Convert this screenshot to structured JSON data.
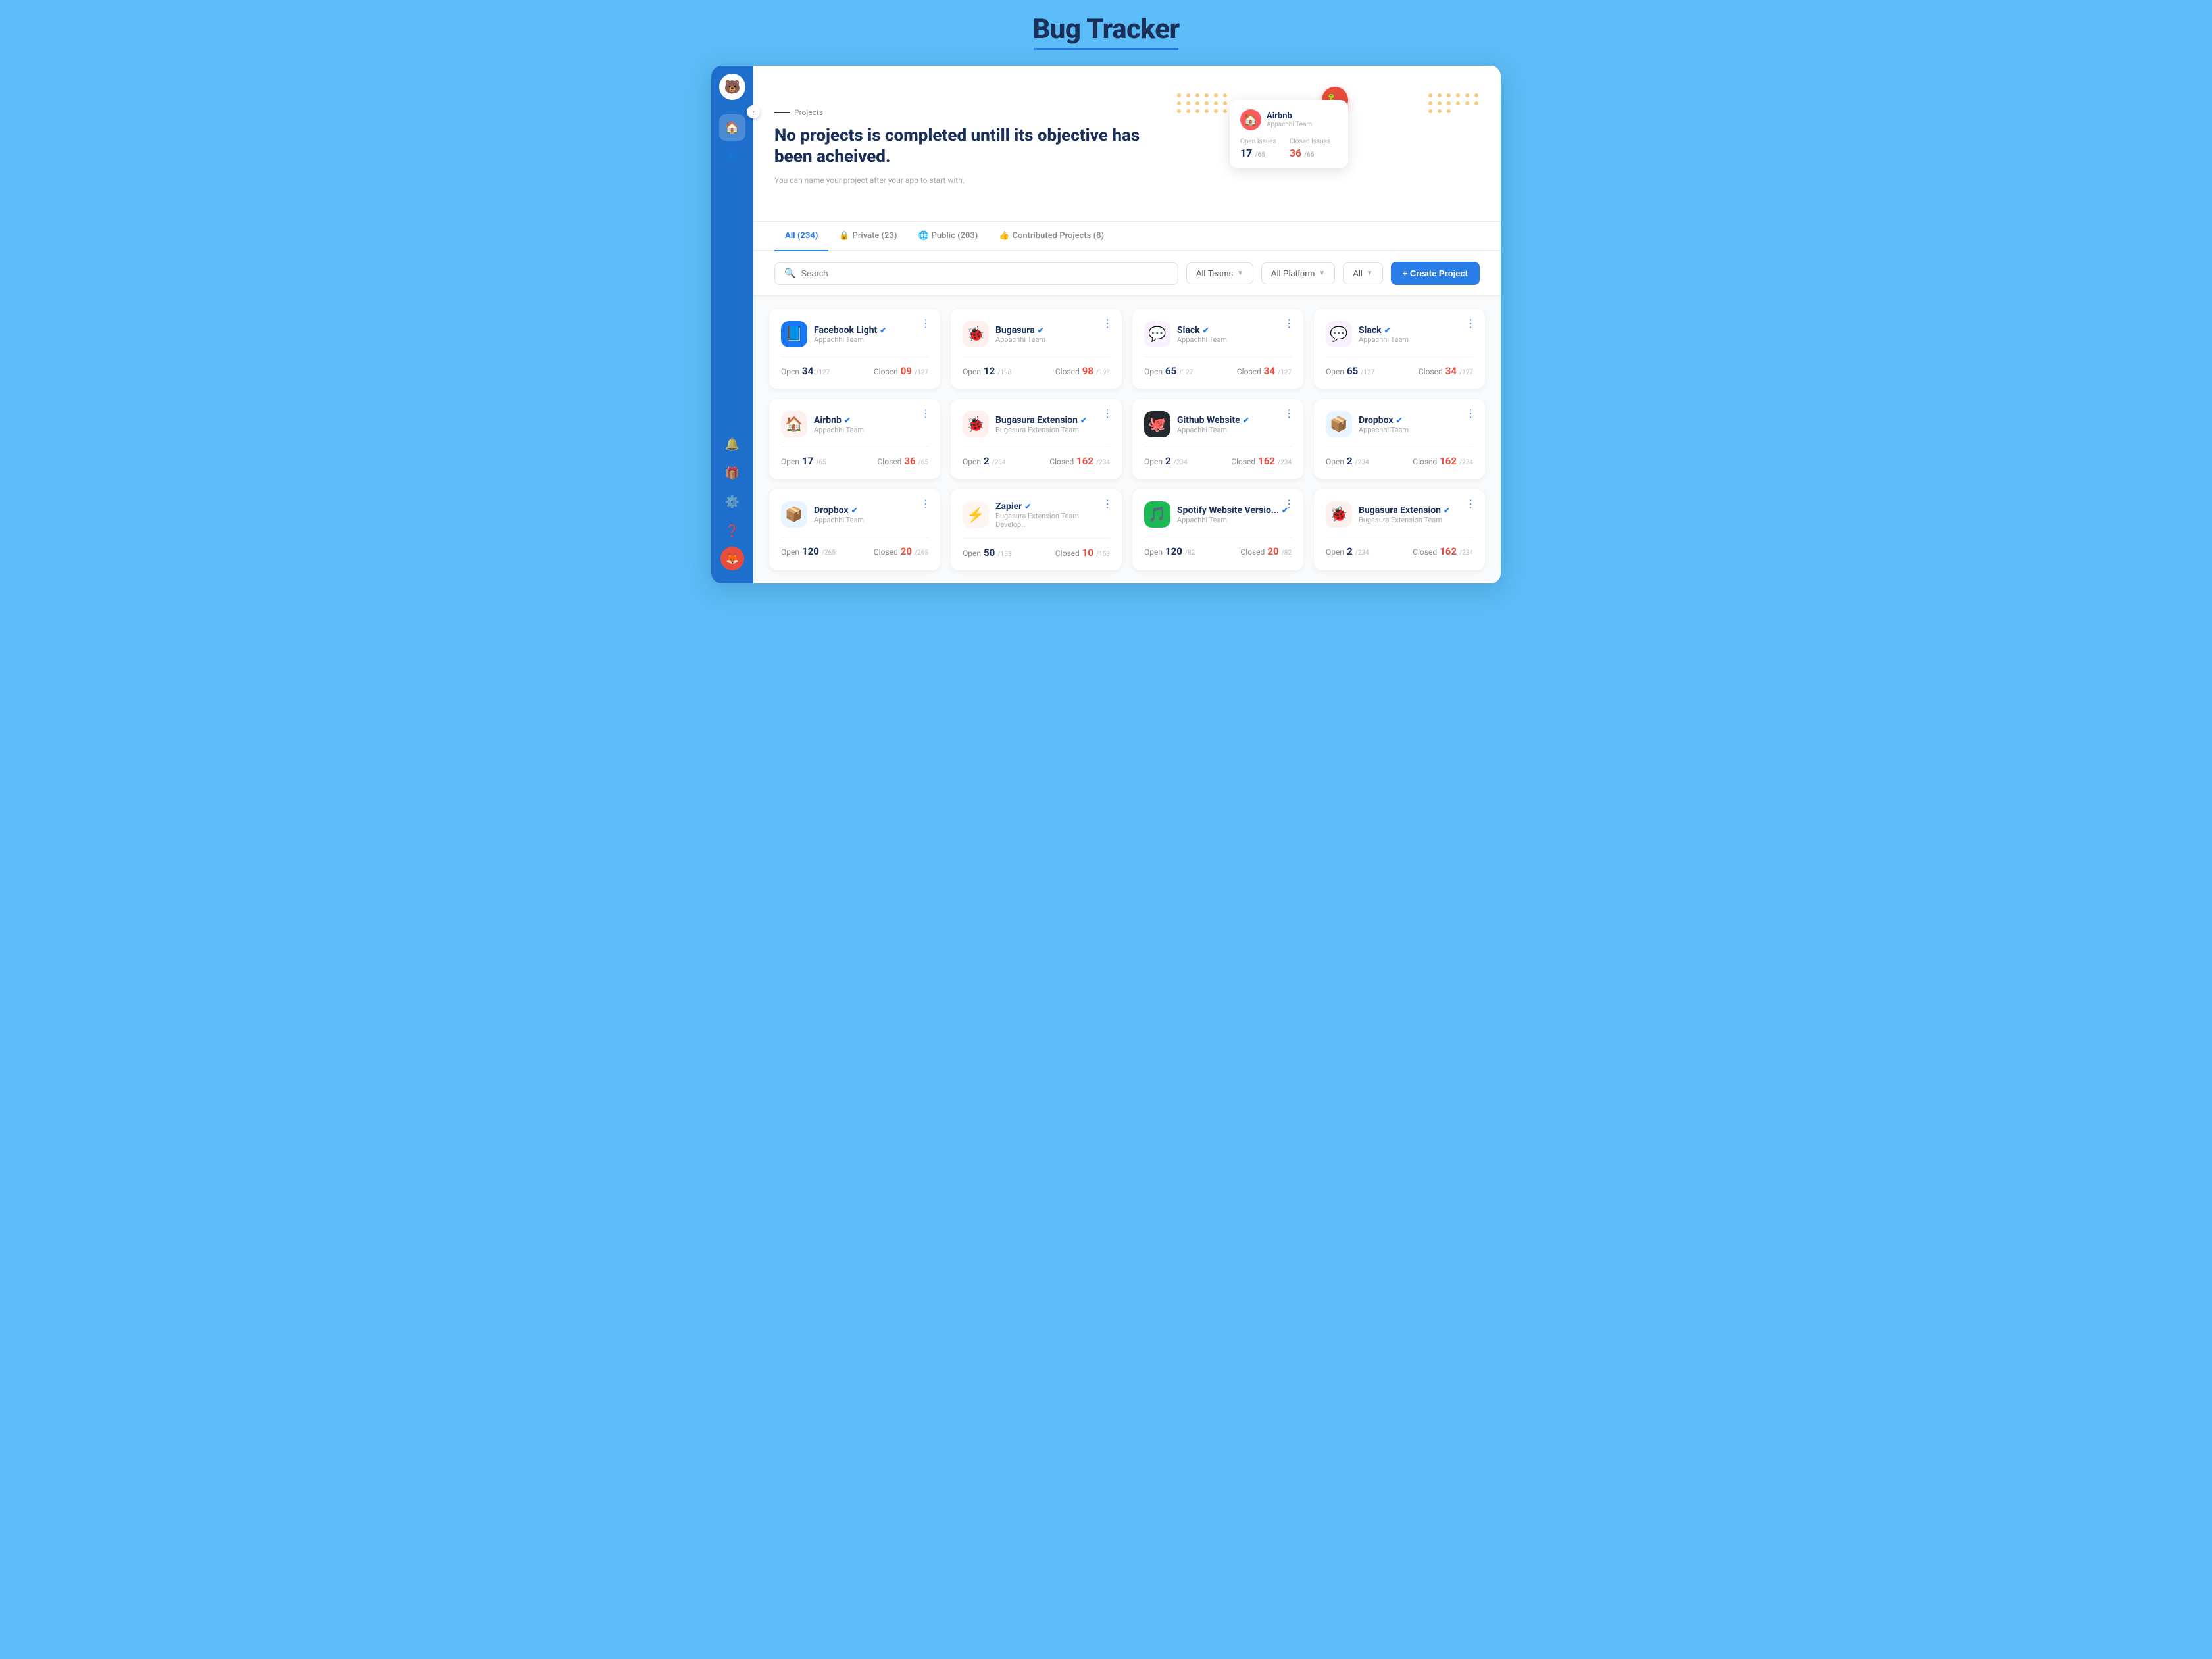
{
  "header": {
    "title": "Bug Tracker"
  },
  "sidebar": {
    "logo": "🐻",
    "items": [
      {
        "id": "home",
        "icon": "🏠",
        "active": true
      },
      {
        "id": "user",
        "icon": "👤",
        "active": false
      }
    ],
    "bottom_items": [
      {
        "id": "bell",
        "icon": "🔔"
      },
      {
        "id": "gift",
        "icon": "🎁"
      },
      {
        "id": "gear",
        "icon": "⚙️"
      },
      {
        "id": "help",
        "icon": "❓"
      }
    ]
  },
  "hero": {
    "label": "Projects",
    "title": "No projects is completed untill its objective has been acheived.",
    "subtitle": "You can name your project after your app to start with.",
    "preview_card": {
      "name": "Airbnb",
      "team": "Appachhi Team",
      "open_issues_label": "Open Issues",
      "open_count": "17",
      "open_total": "/65",
      "closed_issues_label": "Closed Issues",
      "closed_count": "36",
      "closed_total": "/65"
    }
  },
  "tabs": [
    {
      "label": "All (234)",
      "active": true,
      "icon": ""
    },
    {
      "label": "Private (23)",
      "active": false,
      "icon": "🔒"
    },
    {
      "label": "Public (203)",
      "active": false,
      "icon": "🌐"
    },
    {
      "label": "Contributed Projects (8)",
      "active": false,
      "icon": "👍"
    }
  ],
  "filters": {
    "search_placeholder": "Search",
    "all_teams_label": "All Teams",
    "all_platform_label": "All Platform",
    "all_label": "All",
    "create_btn_label": "+ Create Project"
  },
  "projects": [
    {
      "id": 1,
      "name": "Facebook Light",
      "team": "Appachhi Team",
      "logo": "fb",
      "open": "34",
      "open_total": "/127",
      "closed": "09",
      "closed_total": "/127"
    },
    {
      "id": 2,
      "name": "Bugasura",
      "team": "Appachhi Team",
      "logo": "bug",
      "open": "12",
      "open_total": "/198",
      "closed": "98",
      "closed_total": "/198"
    },
    {
      "id": 3,
      "name": "Slack",
      "team": "Appachhi Team",
      "logo": "slack",
      "open": "65",
      "open_total": "/127",
      "closed": "34",
      "closed_total": "/127"
    },
    {
      "id": 4,
      "name": "Slack",
      "team": "Appachhi Team",
      "logo": "slack",
      "open": "65",
      "open_total": "/127",
      "closed": "34",
      "closed_total": "/127"
    },
    {
      "id": 5,
      "name": "Airbnb",
      "team": "Appachhi Team",
      "logo": "airbnb",
      "open": "17",
      "open_total": "/65",
      "closed": "36",
      "closed_total": "/65"
    },
    {
      "id": 6,
      "name": "Bugasura Extension",
      "team": "Bugasura Extension Team",
      "logo": "bug",
      "open": "2",
      "open_total": "/234",
      "closed": "162",
      "closed_total": "/234"
    },
    {
      "id": 7,
      "name": "Github Website",
      "team": "Appachhi Team",
      "logo": "github",
      "open": "2",
      "open_total": "/234",
      "closed": "162",
      "closed_total": "/234"
    },
    {
      "id": 8,
      "name": "Dropbox",
      "team": "Appachhi Team",
      "logo": "dropbox",
      "open": "2",
      "open_total": "/234",
      "closed": "162",
      "closed_total": "/234"
    },
    {
      "id": 9,
      "name": "Dropbox",
      "team": "Appachhi Team",
      "logo": "dropbox",
      "open": "120",
      "open_total": "/265",
      "closed": "20",
      "closed_total": "/265"
    },
    {
      "id": 10,
      "name": "Zapier",
      "team": "Bugasura Extension Team Develop...",
      "logo": "zapier",
      "open": "50",
      "open_total": "/153",
      "closed": "10",
      "closed_total": "/153"
    },
    {
      "id": 11,
      "name": "Spotify Website Versio...",
      "team": "Appachhi Team",
      "logo": "spotify",
      "open": "120",
      "open_total": "/82",
      "closed": "20",
      "closed_total": "/82"
    },
    {
      "id": 12,
      "name": "Bugasura Extension",
      "team": "Bugasura Extension Team",
      "logo": "bug",
      "open": "2",
      "open_total": "/234",
      "closed": "162",
      "closed_total": "/234"
    }
  ]
}
